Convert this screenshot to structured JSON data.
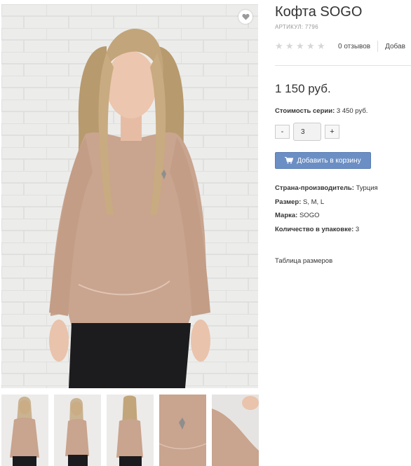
{
  "product": {
    "title": "Кофта SOGO",
    "sku": "АРТИКУЛ: 7796",
    "rating": {
      "value": 0,
      "max": 5,
      "reviews_label": "0 отзывов",
      "add_review_label": "Добав"
    },
    "price": "1 150 руб.",
    "series_label": "Стоимость серии:",
    "series_value": "3 450 руб.",
    "quantity": {
      "minus": "-",
      "value": "3",
      "plus": "+"
    },
    "add_to_cart_label": "Добавить в корзину",
    "properties": [
      {
        "label": "Страна-производитель:",
        "value": "Турция"
      },
      {
        "label": "Размер:",
        "value": "S, M, L"
      },
      {
        "label": "Марка:",
        "value": "SOGO"
      },
      {
        "label": "Количество в упаковке:",
        "value": "3"
      }
    ],
    "size_table_label": "Таблица размеров"
  },
  "gallery": {
    "wishlist_icon": "heart-icon",
    "thumbnail_count": 5
  },
  "colors": {
    "accent_button": "#6b8fc4",
    "sweater": "#c9a48e",
    "star_inactive": "#d6d6d6"
  }
}
